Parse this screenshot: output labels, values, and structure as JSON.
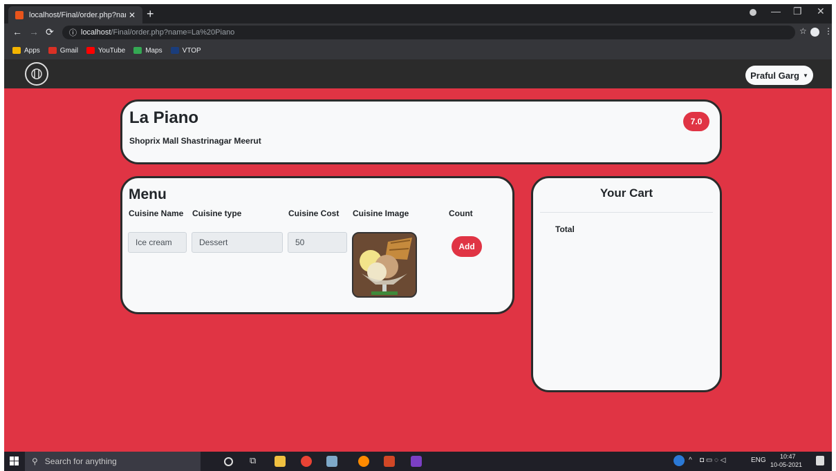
{
  "browser": {
    "tab_title": "localhost/Final/order.php?name=",
    "tab_close": "✕",
    "new_tab": "+",
    "url_host": "localhost",
    "url_path": "/Final/order.php?name=La%20Piano",
    "bookmarks": [
      {
        "label": "Apps",
        "color": "#f4b400"
      },
      {
        "label": "Gmail",
        "color": "#d93025"
      },
      {
        "label": "YouTube",
        "color": "#ff0000"
      },
      {
        "label": "Maps",
        "color": "#34a853"
      },
      {
        "label": "VTOP",
        "color": "#1a3d7c"
      }
    ]
  },
  "navbar": {
    "logo_icon": "restaurant-logo-icon",
    "user_name": "Praful Garg"
  },
  "restaurant": {
    "name": "La Piano",
    "address": "Shoprix Mall Shastrinagar Meerut",
    "rating": "7.0"
  },
  "menu": {
    "title": "Menu",
    "columns": [
      "Cuisine Name",
      "Cuisine type",
      "Cuisine Cost",
      "Cuisine Image",
      "Count"
    ],
    "items": [
      {
        "name": "Ice cream",
        "type": "Dessert",
        "cost": "50",
        "add_label": "Add"
      }
    ]
  },
  "cart": {
    "title": "Your Cart",
    "total_label": "Total"
  },
  "taskbar": {
    "search_placeholder": "Search for anything",
    "language": "ENG",
    "time": "10:47",
    "date": "10-05-2021"
  },
  "colors": {
    "page_bg": "#e03444",
    "card_bg": "#f8f9fa",
    "navbar_bg": "#2b2b2b",
    "accent": "#e03444"
  }
}
